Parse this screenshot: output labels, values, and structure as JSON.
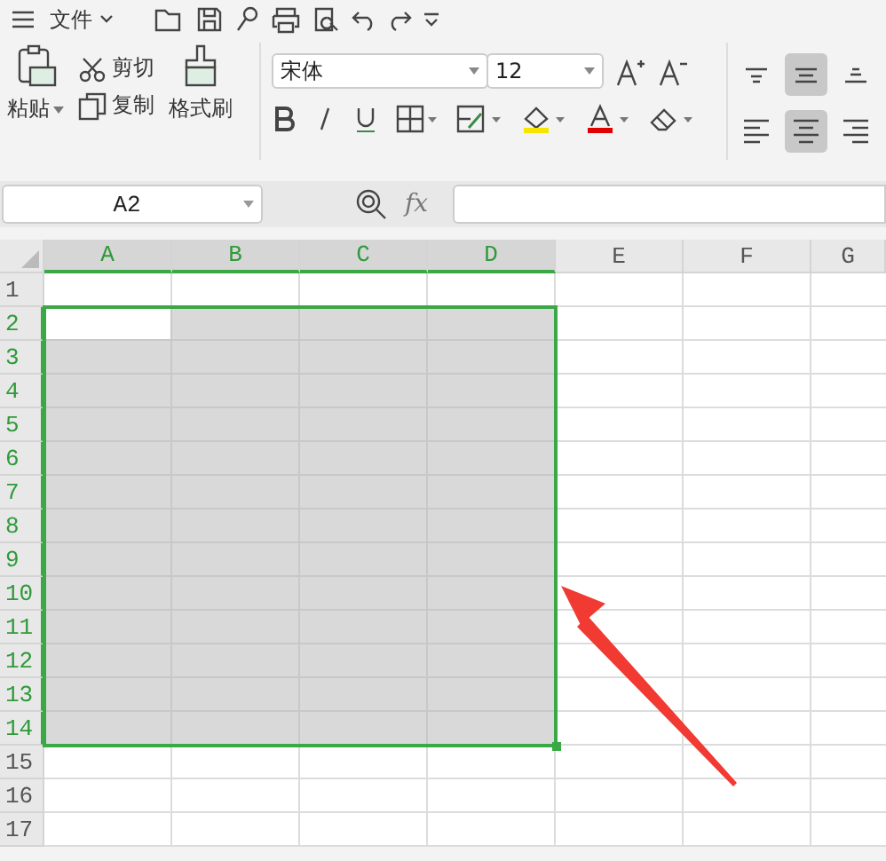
{
  "menu": {
    "label": "文件"
  },
  "clipboard": {
    "paste": "粘贴",
    "cut": "剪切",
    "copy": "复制",
    "format_painter": "格式刷"
  },
  "font": {
    "name": "宋体",
    "size": "12"
  },
  "alignment": [
    {
      "kind": "top",
      "selected": false
    },
    {
      "kind": "middle",
      "selected": true
    },
    {
      "kind": "bottom",
      "selected": false
    },
    {
      "kind": "left",
      "selected": false
    },
    {
      "kind": "center",
      "selected": true
    },
    {
      "kind": "right",
      "selected": false
    }
  ],
  "formula_bar": {
    "name_box": "A2",
    "fx": "fx"
  },
  "columns": [
    {
      "label": "A",
      "selected": true,
      "active": true
    },
    {
      "label": "B",
      "selected": true,
      "active": false
    },
    {
      "label": "C",
      "selected": true,
      "active": false
    },
    {
      "label": "D",
      "selected": true,
      "active": false
    },
    {
      "label": "E",
      "selected": false,
      "active": false
    },
    {
      "label": "F",
      "selected": false,
      "active": false
    },
    {
      "label": "G",
      "selected": false,
      "active": false
    }
  ],
  "rows": [
    {
      "label": "1",
      "selected": false,
      "active": false
    },
    {
      "label": "2",
      "selected": true,
      "active": true
    },
    {
      "label": "3",
      "selected": true,
      "active": false
    },
    {
      "label": "4",
      "selected": true,
      "active": false
    },
    {
      "label": "5",
      "selected": true,
      "active": false
    },
    {
      "label": "6",
      "selected": true,
      "active": false
    },
    {
      "label": "7",
      "selected": true,
      "active": false
    },
    {
      "label": "8",
      "selected": true,
      "active": false
    },
    {
      "label": "9",
      "selected": true,
      "active": false
    },
    {
      "label": "10",
      "selected": true,
      "active": false
    },
    {
      "label": "11",
      "selected": true,
      "active": false
    },
    {
      "label": "12",
      "selected": true,
      "active": false
    },
    {
      "label": "13",
      "selected": true,
      "active": false
    },
    {
      "label": "14",
      "selected": true,
      "active": false
    },
    {
      "label": "15",
      "selected": false,
      "active": false
    },
    {
      "label": "16",
      "selected": false,
      "active": false
    },
    {
      "label": "17",
      "selected": false,
      "active": false
    }
  ]
}
